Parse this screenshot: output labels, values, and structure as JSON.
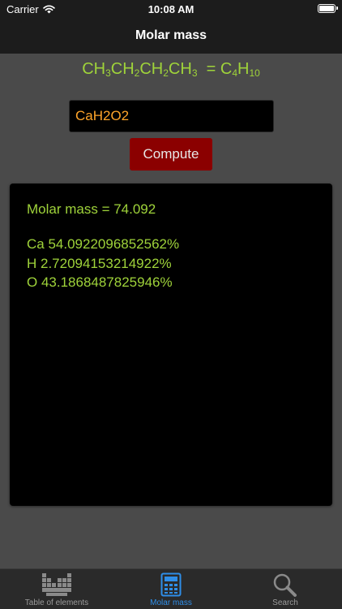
{
  "status_bar": {
    "carrier": "Carrier",
    "time": "10:08 AM"
  },
  "nav": {
    "title": "Molar mass"
  },
  "example": {
    "lhs_parts": [
      "CH",
      "3",
      "CH",
      "2",
      "CH",
      "2",
      "CH",
      "3"
    ],
    "equals": " = ",
    "rhs_parts": [
      "C",
      "4",
      "H",
      "10"
    ]
  },
  "input": {
    "value": "CaH2O2"
  },
  "compute_button": {
    "label": "Compute"
  },
  "results": {
    "molar_mass_line": "Molar mass = 74.092",
    "composition": [
      "Ca 54.0922096852562%",
      "H 2.72094153214922%",
      "O 43.1868487825946%"
    ]
  },
  "tabs": [
    {
      "label": "Table of elements",
      "icon": "periodic-table-icon",
      "active": false
    },
    {
      "label": "Molar mass",
      "icon": "calculator-icon",
      "active": true
    },
    {
      "label": "Search",
      "icon": "magnifier-icon",
      "active": false
    }
  ],
  "colors": {
    "accent_green": "#9fd33a",
    "input_text_orange": "#ffa52a",
    "button_red": "#8b0000",
    "tab_active_blue": "#2f8ee8",
    "background": "#4a4a4a"
  }
}
